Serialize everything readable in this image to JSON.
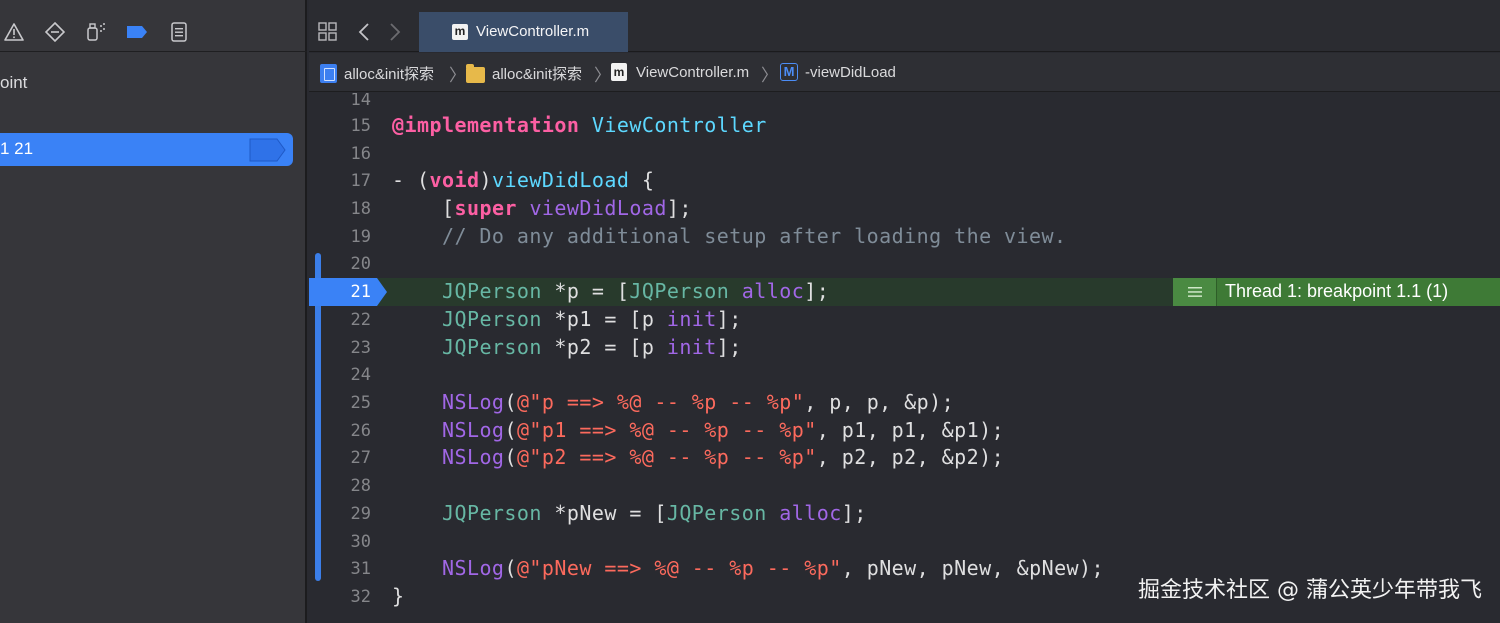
{
  "navigator": {
    "icons": [
      "warning-icon",
      "breakpoint-diamond-icon",
      "debug-spray-icon",
      "breakpoint-tag-icon",
      "report-icon"
    ],
    "partial_label": "oint",
    "selected_row_label": "1 21",
    "selected_row_color": "#3a82f6"
  },
  "tabbar": {
    "icons": [
      "grid-icon",
      "back-icon",
      "forward-icon"
    ],
    "active_tab_icon": "m",
    "active_tab_label": "ViewController.m"
  },
  "breadcrumb": {
    "items": [
      {
        "icon": "project-icon",
        "label": "alloc&init探索"
      },
      {
        "icon": "folder-icon",
        "label": "alloc&init探索"
      },
      {
        "icon": "m",
        "label": "ViewController.m"
      },
      {
        "icon": "M",
        "label": "-viewDidLoad"
      }
    ],
    "separator": "〉"
  },
  "editor": {
    "current_line": "21",
    "thread_badge": "Thread 1: breakpoint 1.1 (1)",
    "lines": [
      {
        "n": "14",
        "code": ""
      },
      {
        "n": "15",
        "code": "@implementation ViewController"
      },
      {
        "n": "16",
        "code": ""
      },
      {
        "n": "17",
        "code": "- (void)viewDidLoad {"
      },
      {
        "n": "18",
        "code": "    [super viewDidLoad];"
      },
      {
        "n": "19",
        "code": "    // Do any additional setup after loading the view."
      },
      {
        "n": "20",
        "code": ""
      },
      {
        "n": "21",
        "code": "    JQPerson *p = [JQPerson alloc];"
      },
      {
        "n": "22",
        "code": "    JQPerson *p1 = [p init];"
      },
      {
        "n": "23",
        "code": "    JQPerson *p2 = [p init];"
      },
      {
        "n": "24",
        "code": ""
      },
      {
        "n": "25",
        "code": "    NSLog(@\"p ==> %@ -- %p -- %p\", p, p, &p);"
      },
      {
        "n": "26",
        "code": "    NSLog(@\"p1 ==> %@ -- %p -- %p\", p1, p1, &p1);"
      },
      {
        "n": "27",
        "code": "    NSLog(@\"p2 ==> %@ -- %p -- %p\", p2, p2, &p2);"
      },
      {
        "n": "28",
        "code": ""
      },
      {
        "n": "29",
        "code": "    JQPerson *pNew = [JQPerson alloc];"
      },
      {
        "n": "30",
        "code": ""
      },
      {
        "n": "31",
        "code": "    NSLog(@\"pNew ==> %@ -- %p -- %p\", pNew, pNew, &pNew);"
      },
      {
        "n": "32",
        "code": "}"
      }
    ]
  },
  "colors": {
    "keyword": "#fc5fa3",
    "class": "#5dd8ff",
    "function": "#67b7a4",
    "string": "#fc6a5d",
    "comment": "#7f8c98",
    "breakpoint": "#3a82f6",
    "current_line_badge": "#3e7a36"
  },
  "watermark": "掘金技术社区 @ 蒲公英少年带我飞"
}
